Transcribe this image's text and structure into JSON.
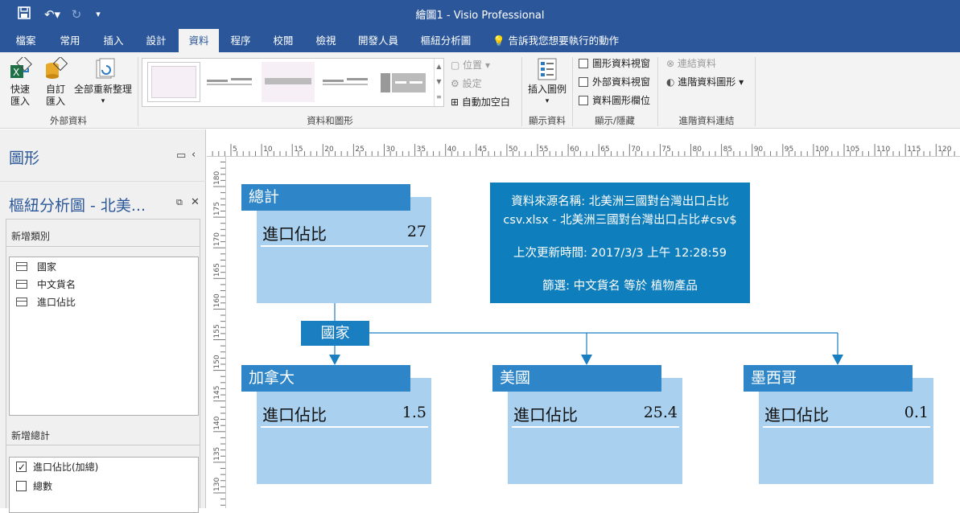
{
  "titlebar": {
    "title": "繪圖1 - Visio Professional"
  },
  "tabs": [
    {
      "label": "檔案"
    },
    {
      "label": "常用"
    },
    {
      "label": "插入"
    },
    {
      "label": "設計"
    },
    {
      "label": "資料"
    },
    {
      "label": "程序"
    },
    {
      "label": "校閱"
    },
    {
      "label": "檢視"
    },
    {
      "label": "開發人員"
    },
    {
      "label": "樞紐分析圖"
    }
  ],
  "tell_me": "告訴我您想要執行的動作",
  "ribbon": {
    "quick_import_1": "快速",
    "quick_import_2": "匯入",
    "custom_import_1": "自訂",
    "custom_import_2": "匯入",
    "refresh_all": "全部重新整理",
    "group_external": "外部資料",
    "position": "位置",
    "settings": "設定",
    "auto_space": "自動加空白",
    "group_data_graphics": "資料和圖形",
    "insert_legend": "插入圖例",
    "group_display_data": "顯示資料",
    "shape_data_window": "圖形資料視窗",
    "external_data_window": "外部資料視窗",
    "data_graphic_fields": "資料圖形欄位",
    "group_show_hide": "顯示/隱藏",
    "link_data": "連結資料",
    "advanced_data_graphics": "進階資料圖形",
    "group_advanced_link": "進階資料連結"
  },
  "panel": {
    "shapes_title": "圖形",
    "pivot_title": "樞紐分析圖 - 北美...",
    "add_category_label": "新增類別",
    "categories": [
      {
        "label": "國家"
      },
      {
        "label": "中文貨名"
      },
      {
        "label": "進口佔比"
      }
    ],
    "add_total_label": "新增總計",
    "totals": [
      {
        "label": "進口佔比(加總)",
        "checked": true
      },
      {
        "label": "總數",
        "checked": false
      }
    ]
  },
  "ruler": {
    "top_ticks": [
      "5",
      "10",
      "15",
      "20",
      "25",
      "30",
      "35",
      "40",
      "45",
      "50",
      "55",
      "60",
      "65",
      "70",
      "75",
      "80",
      "85",
      "90",
      "95",
      "100",
      "105",
      "110",
      "115",
      "120"
    ],
    "left_ticks": [
      "180",
      "175",
      "170",
      "165",
      "160",
      "155",
      "150",
      "145",
      "140",
      "135",
      "130"
    ]
  },
  "diagram": {
    "info": {
      "line1": "資料來源名稱: 北美洲三國對台灣出口占比",
      "line2": "csv.xlsx - 北美洲三國對台灣出口占比#csv$",
      "line3": "上次更新時間: 2017/3/3 上午 12:28:59",
      "line4": "篩選: 中文貨名 等於 植物產品"
    },
    "category": "國家",
    "nodes": [
      {
        "title": "總計",
        "field": "進口佔比",
        "value": "27"
      },
      {
        "title": "加拿大",
        "field": "進口佔比",
        "value": "1.5"
      },
      {
        "title": "美國",
        "field": "進口佔比",
        "value": "25.4"
      },
      {
        "title": "墨西哥",
        "field": "進口佔比",
        "value": "0.1"
      }
    ]
  },
  "colors": {
    "brand": "#2b579a",
    "node_header": "#2e86c9",
    "node_body": "#a9d0ee",
    "info_box": "#0f7ebc"
  }
}
